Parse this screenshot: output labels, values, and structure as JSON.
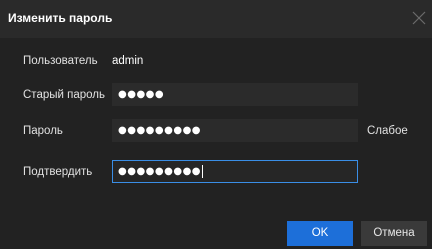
{
  "dialog": {
    "title": "Изменить пароль",
    "close_icon": "close-icon"
  },
  "form": {
    "user_label": "Пользователь",
    "user_value": "admin",
    "old_password_label": "Старый пароль",
    "old_password_value": "●●●●●",
    "password_label": "Пароль",
    "password_value": "●●●●●●●●●",
    "strength_label": "Слабое",
    "confirm_label": "Подтвердить",
    "confirm_value": "●●●●●●●●●"
  },
  "buttons": {
    "ok_label": "OK",
    "cancel_label": "Отмена"
  },
  "colors": {
    "background": "#222222",
    "titlebar": "#2a2a2a",
    "field": "#2b2b2b",
    "focus_border": "#3a8ee6",
    "primary": "#1d6fd9",
    "secondary": "#3a3a3a"
  }
}
